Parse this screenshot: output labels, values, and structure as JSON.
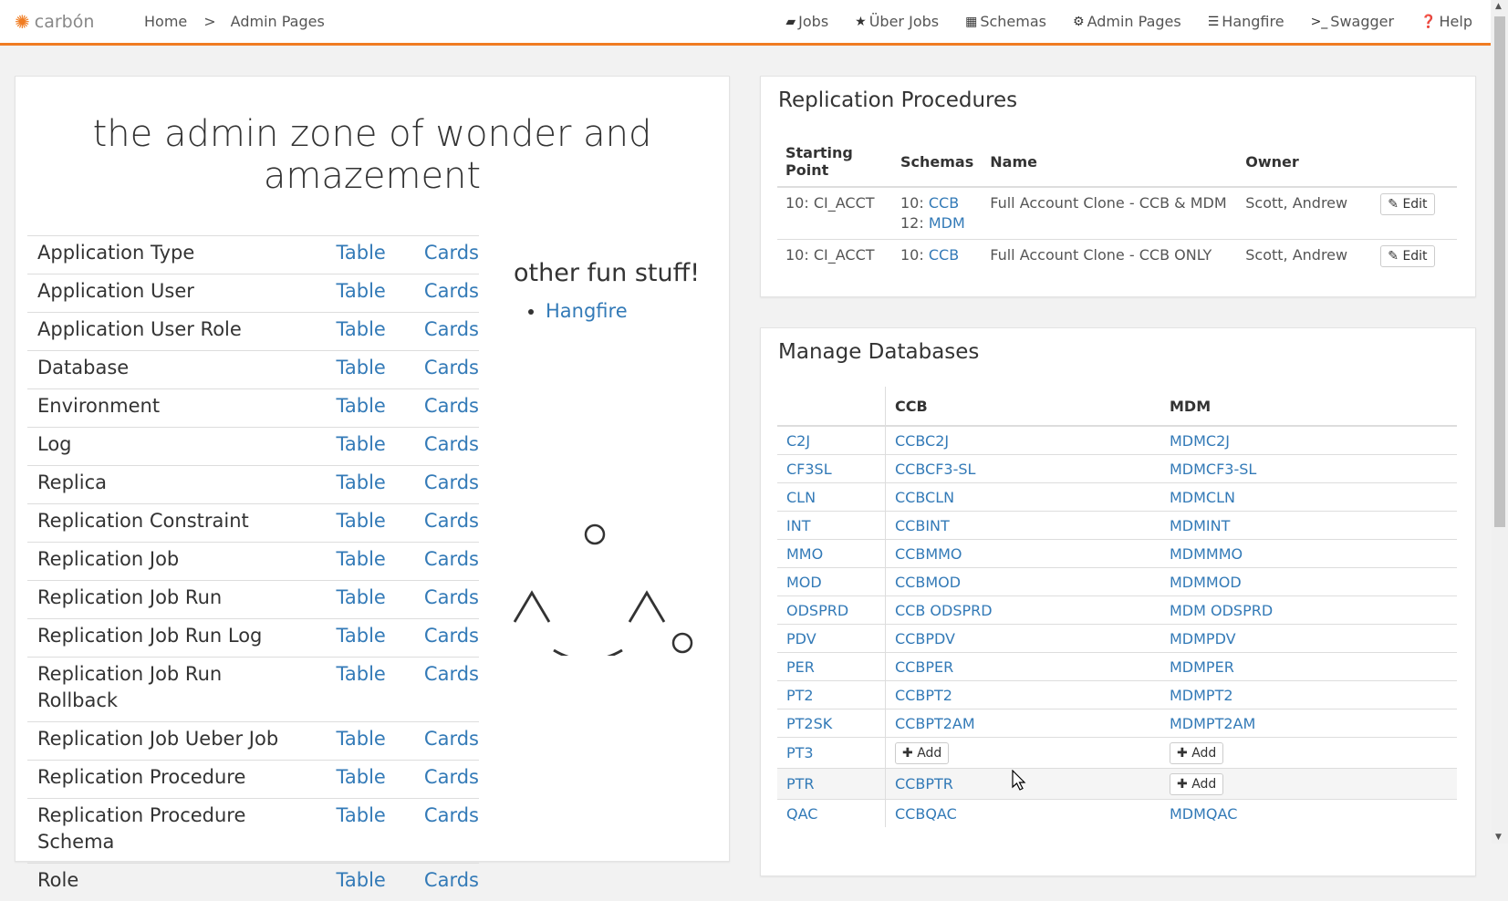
{
  "topbar": {
    "brand": "carbón",
    "breadcrumb": [
      "Home",
      ">",
      "Admin Pages"
    ],
    "nav": [
      {
        "icon": "briefcase-icon",
        "glyph": "▰",
        "label": "Jobs"
      },
      {
        "icon": "star-icon",
        "glyph": "★",
        "label": "Über Jobs"
      },
      {
        "icon": "table-icon",
        "glyph": "▦",
        "label": "Schemas"
      },
      {
        "icon": "cogs-icon",
        "glyph": "⚙",
        "label": "Admin Pages"
      },
      {
        "icon": "list-icon",
        "glyph": "☰",
        "label": "Hangfire"
      },
      {
        "icon": "terminal-icon",
        "glyph": ">_",
        "label": "Swagger"
      },
      {
        "icon": "question-icon",
        "glyph": "❓",
        "label": "Help"
      }
    ]
  },
  "left": {
    "hero_line1": "the admin zone of wonder and",
    "hero_line2": "amazement",
    "entities": [
      {
        "name": "Application Type",
        "table": "Table",
        "cards": "Cards"
      },
      {
        "name": "Application User",
        "table": "Table",
        "cards": "Cards"
      },
      {
        "name": "Application User Role",
        "table": "Table",
        "cards": "Cards"
      },
      {
        "name": "Database",
        "table": "Table",
        "cards": "Cards"
      },
      {
        "name": "Environment",
        "table": "Table",
        "cards": "Cards"
      },
      {
        "name": "Log",
        "table": "Table",
        "cards": "Cards"
      },
      {
        "name": "Replica",
        "table": "Table",
        "cards": "Cards"
      },
      {
        "name": "Replication Constraint",
        "table": "Table",
        "cards": "Cards"
      },
      {
        "name": "Replication Job",
        "table": "Table",
        "cards": "Cards"
      },
      {
        "name": "Replication Job Run",
        "table": "Table",
        "cards": "Cards"
      },
      {
        "name": "Replication Job Run Log",
        "table": "Table",
        "cards": "Cards"
      },
      {
        "name": "Replication Job Run Rollback",
        "table": "Table",
        "cards": "Cards"
      },
      {
        "name": "Replication Job Ueber Job",
        "table": "Table",
        "cards": "Cards"
      },
      {
        "name": "Replication Procedure",
        "table": "Table",
        "cards": "Cards"
      },
      {
        "name": "Replication Procedure Schema",
        "table": "Table",
        "cards": "Cards"
      },
      {
        "name": "Role",
        "table": "Table",
        "cards": "Cards"
      }
    ],
    "fun_title": "other fun stuff!",
    "fun_links": [
      "Hangfire"
    ]
  },
  "replication": {
    "title": "Replication Procedures",
    "headers": [
      "Starting Point",
      "Schemas",
      "Name",
      "Owner",
      ""
    ],
    "rows": [
      {
        "start": "10: CI_ACCT",
        "schemas": [
          {
            "num": "10:",
            "name": "CCB"
          },
          {
            "num": "12:",
            "name": "MDM"
          }
        ],
        "name": "Full Account Clone - CCB & MDM",
        "owner": "Scott, Andrew",
        "edit": "Edit"
      },
      {
        "start": "10: CI_ACCT",
        "schemas": [
          {
            "num": "10:",
            "name": "CCB"
          }
        ],
        "name": "Full Account Clone - CCB ONLY",
        "owner": "Scott, Andrew",
        "edit": "Edit"
      }
    ]
  },
  "databases": {
    "title": "Manage Databases",
    "headers": [
      "",
      "CCB",
      "MDM"
    ],
    "add_label": "Add",
    "rows": [
      {
        "env": "C2J",
        "ccb": "CCBC2J",
        "mdm": "MDMC2J"
      },
      {
        "env": "CF3SL",
        "ccb": "CCBCF3-SL",
        "mdm": "MDMCF3-SL"
      },
      {
        "env": "CLN",
        "ccb": "CCBCLN",
        "mdm": "MDMCLN"
      },
      {
        "env": "INT",
        "ccb": "CCBINT",
        "mdm": "MDMINT"
      },
      {
        "env": "MMO",
        "ccb": "CCBMMO",
        "mdm": "MDMMMO"
      },
      {
        "env": "MOD",
        "ccb": "CCBMOD",
        "mdm": "MDMMOD"
      },
      {
        "env": "ODSPRD",
        "ccb": "CCB ODSPRD",
        "mdm": "MDM ODSPRD"
      },
      {
        "env": "PDV",
        "ccb": "CCBPDV",
        "mdm": "MDMPDV"
      },
      {
        "env": "PER",
        "ccb": "CCBPER",
        "mdm": "MDMPER"
      },
      {
        "env": "PT2",
        "ccb": "CCBPT2",
        "mdm": "MDMPT2"
      },
      {
        "env": "PT2SK",
        "ccb": "CCBPT2AM",
        "mdm": "MDMPT2AM"
      },
      {
        "env": "PT3",
        "ccb": null,
        "mdm": null
      },
      {
        "env": "PTR",
        "ccb": "CCBPTR",
        "mdm": null,
        "shade": true
      },
      {
        "env": "QAC",
        "ccb": "CCBQAC",
        "mdm": "MDMQAC"
      }
    ]
  },
  "colors": {
    "accent": "#f07c22",
    "link": "#337ab7"
  }
}
